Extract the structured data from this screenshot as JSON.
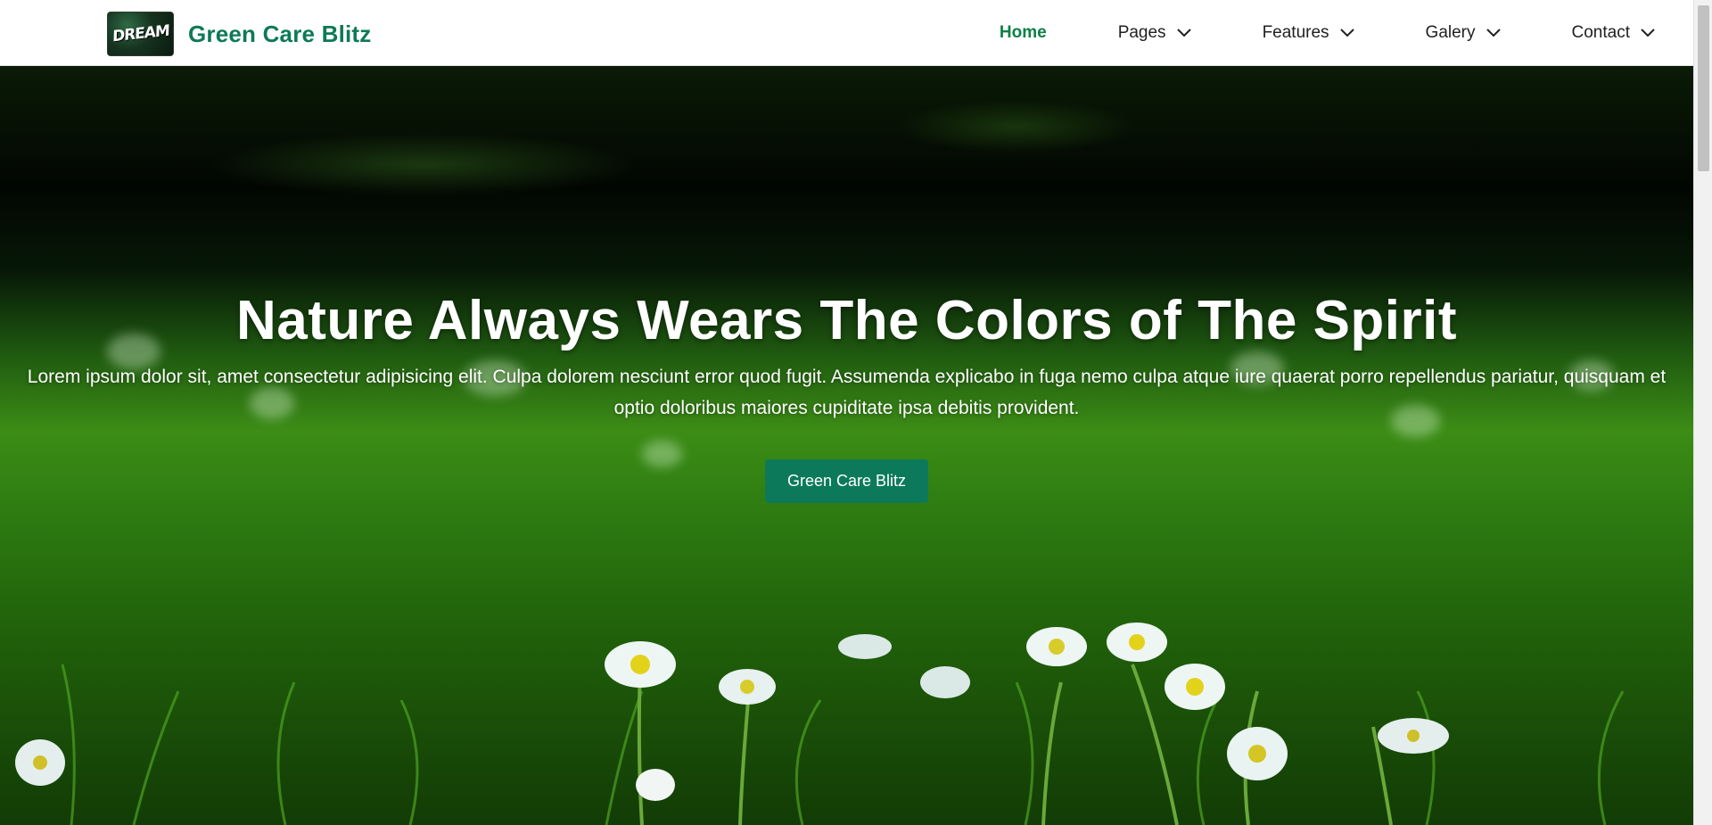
{
  "brand": {
    "logo_text": "DREAM",
    "name": "Green Care Blitz"
  },
  "nav": {
    "items": [
      {
        "label": "Home",
        "active": true,
        "dropdown": false
      },
      {
        "label": "Pages",
        "active": false,
        "dropdown": true
      },
      {
        "label": "Features",
        "active": false,
        "dropdown": true
      },
      {
        "label": "Galery",
        "active": false,
        "dropdown": true
      },
      {
        "label": "Contact",
        "active": false,
        "dropdown": true
      }
    ]
  },
  "hero": {
    "title": "Nature Always Wears The Colors of The Spirit",
    "text": "Lorem ipsum dolor sit, amet consectetur adipisicing elit. Culpa dolorem nesciunt error quod fugit. Assumenda explicabo in fuga nemo culpa atque iure quaerat porro repellendus pariatur, quisquam et optio doloribus maiores cupiditate ipsa debitis provident.",
    "button_label": "Green Care Blitz",
    "background": "green grass field with white daisies"
  },
  "colors": {
    "brand_green": "#0d7a55",
    "active_nav": "#0b8045",
    "button_bg": "#0c7a5a"
  },
  "icons": {
    "dropdown": "chevron-down-icon"
  }
}
